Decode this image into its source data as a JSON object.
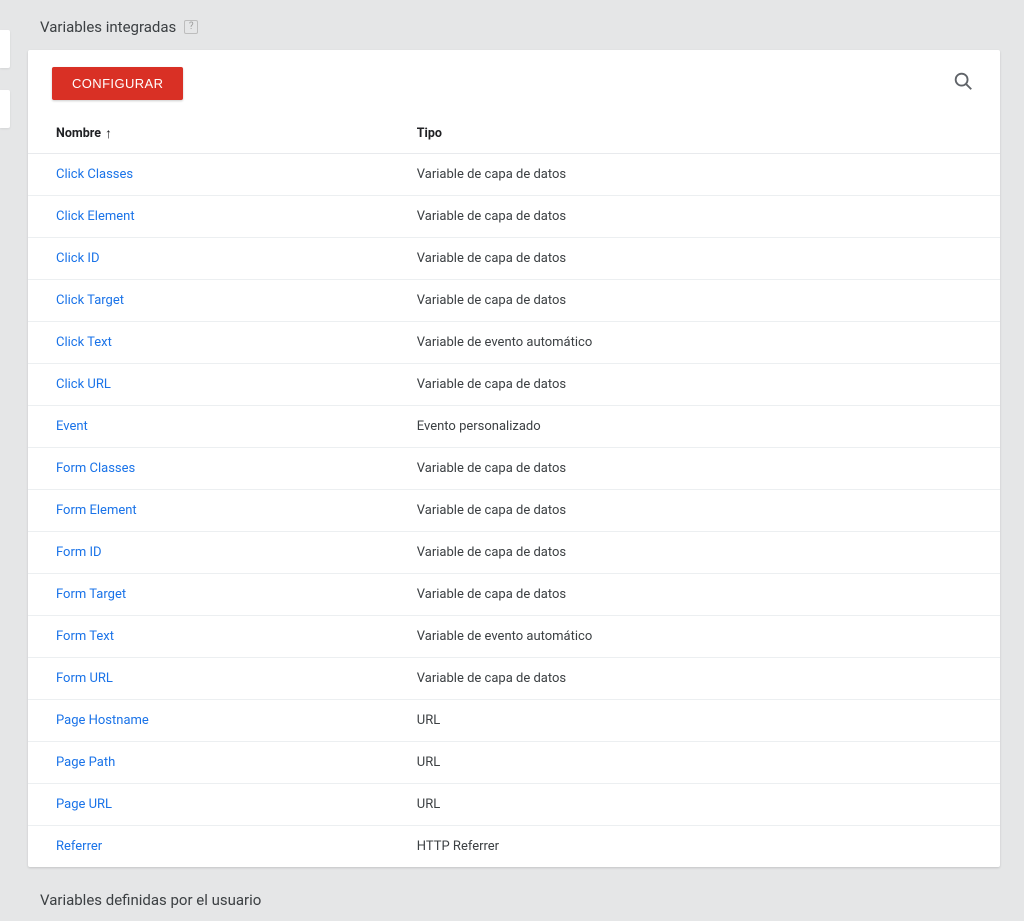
{
  "sections": {
    "builtin_title": "Variables integradas",
    "user_defined_title": "Variables definidas por el usuario"
  },
  "toolbar": {
    "configure_label": "CONFIGURAR"
  },
  "table": {
    "headers": {
      "name": "Nombre",
      "type": "Tipo"
    },
    "rows": [
      {
        "name": "Click Classes",
        "type": "Variable de capa de datos"
      },
      {
        "name": "Click Element",
        "type": "Variable de capa de datos"
      },
      {
        "name": "Click ID",
        "type": "Variable de capa de datos"
      },
      {
        "name": "Click Target",
        "type": "Variable de capa de datos"
      },
      {
        "name": "Click Text",
        "type": "Variable de evento automático"
      },
      {
        "name": "Click URL",
        "type": "Variable de capa de datos"
      },
      {
        "name": "Event",
        "type": "Evento personalizado"
      },
      {
        "name": "Form Classes",
        "type": "Variable de capa de datos"
      },
      {
        "name": "Form Element",
        "type": "Variable de capa de datos"
      },
      {
        "name": "Form ID",
        "type": "Variable de capa de datos"
      },
      {
        "name": "Form Target",
        "type": "Variable de capa de datos"
      },
      {
        "name": "Form Text",
        "type": "Variable de evento automático"
      },
      {
        "name": "Form URL",
        "type": "Variable de capa de datos"
      },
      {
        "name": "Page Hostname",
        "type": "URL"
      },
      {
        "name": "Page Path",
        "type": "URL"
      },
      {
        "name": "Page URL",
        "type": "URL"
      },
      {
        "name": "Referrer",
        "type": "HTTP Referrer"
      }
    ]
  }
}
